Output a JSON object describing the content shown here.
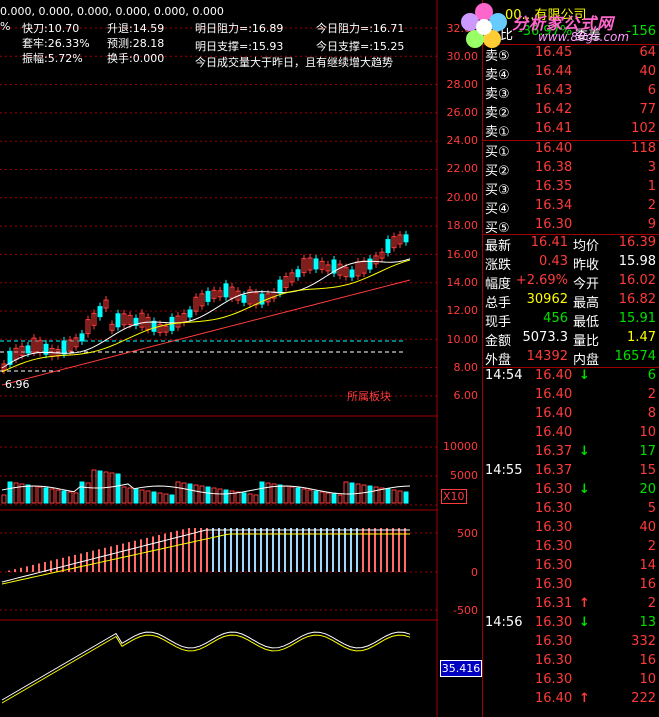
{
  "top_line": "0.000, 0.000, 0.000, 0.000, 0.000, 0.000",
  "info": {
    "kuaidao": "快刀:10.70",
    "shengtui": "升退:14.59",
    "ming_zuli": "明日阻力=:16.89",
    "jin_zuli": "今日阻力=:16.71",
    "pct": "%",
    "taolao": "套牢:26.33%",
    "yuce": "预测:28.18",
    "ming_zhicheng": "明日支撑=:15.93",
    "jin_zhicheng": "今日支撑=:15.25",
    "zhenfu": "振幅:5.72%",
    "huanshou": "换手:0.000",
    "note": "今日成交量大于昨日，且有继续增大趋势"
  },
  "price_axis": [
    "32.00",
    "30.00",
    "28.00",
    "26.00",
    "24.00",
    "22.00",
    "20.00",
    "18.00",
    "16.00",
    "14.00",
    "12.00",
    "10.00",
    "8.00",
    "6.00"
  ],
  "low_label": "6.96",
  "sector_label": "所属板块",
  "vol_axis": [
    "10000",
    "5000"
  ],
  "vol_unit": "X10",
  "macd_axis": [
    "500",
    "0",
    "-500"
  ],
  "kdj_value": "35.416",
  "header": {
    "code": "00",
    "title_rest": "…有限公司",
    "weibi_label": "委比",
    "weibi_value": "-36.97%",
    "weicha_label": "委差",
    "weicha_value": "-156"
  },
  "watermark": {
    "site_cn": "分析家公式网",
    "site_url": "www.88gs.com"
  },
  "sell_orders": [
    {
      "label": "卖⑤",
      "price": "16.45",
      "vol": "64"
    },
    {
      "label": "卖④",
      "price": "16.44",
      "vol": "40"
    },
    {
      "label": "卖③",
      "price": "16.43",
      "vol": "6"
    },
    {
      "label": "卖②",
      "price": "16.42",
      "vol": "77"
    },
    {
      "label": "卖①",
      "price": "16.41",
      "vol": "102"
    }
  ],
  "buy_orders": [
    {
      "label": "买①",
      "price": "16.40",
      "vol": "118"
    },
    {
      "label": "买②",
      "price": "16.38",
      "vol": "3"
    },
    {
      "label": "买③",
      "price": "16.35",
      "vol": "1"
    },
    {
      "label": "买④",
      "price": "16.34",
      "vol": "2"
    },
    {
      "label": "买⑤",
      "price": "16.30",
      "vol": "9"
    }
  ],
  "stats": [
    {
      "l1": "最新",
      "v1": "16.41",
      "l2": "均价",
      "v2": "16.39",
      "c1": "red",
      "c2": "red"
    },
    {
      "l1": "涨跌",
      "v1": "0.43",
      "l2": "昨收",
      "v2": "15.98",
      "c1": "red",
      "c2": "white"
    },
    {
      "l1": "幅度",
      "v1": "+2.69%",
      "l2": "今开",
      "v2": "16.02",
      "c1": "red",
      "c2": "red"
    },
    {
      "l1": "总手",
      "v1": "30962",
      "l2": "最高",
      "v2": "16.82",
      "c1": "yellow",
      "c2": "red"
    },
    {
      "l1": "现手",
      "v1": "456",
      "l2": "最低",
      "v2": "15.91",
      "c1": "green",
      "c2": "green"
    },
    {
      "l1": "金额",
      "v1": "5073.3",
      "l2": "量比",
      "v2": "1.47",
      "c1": "white",
      "c2": "yellow"
    },
    {
      "l1": "外盘",
      "v1": "14392",
      "l2": "内盘",
      "v2": "16574",
      "c1": "red",
      "c2": "green"
    }
  ],
  "ticks": [
    {
      "time": "14:54",
      "price": "16.40",
      "dir": "down",
      "vol": "6",
      "pc": "red",
      "vc": "green"
    },
    {
      "time": "",
      "price": "16.40",
      "dir": "",
      "vol": "2",
      "pc": "red",
      "vc": "red"
    },
    {
      "time": "",
      "price": "16.40",
      "dir": "",
      "vol": "8",
      "pc": "red",
      "vc": "red"
    },
    {
      "time": "",
      "price": "16.40",
      "dir": "",
      "vol": "10",
      "pc": "red",
      "vc": "red"
    },
    {
      "time": "",
      "price": "16.37",
      "dir": "down",
      "vol": "17",
      "pc": "red",
      "vc": "green"
    },
    {
      "time": "14:55",
      "price": "16.37",
      "dir": "",
      "vol": "15",
      "pc": "red",
      "vc": "red"
    },
    {
      "time": "",
      "price": "16.30",
      "dir": "down",
      "vol": "20",
      "pc": "red",
      "vc": "green"
    },
    {
      "time": "",
      "price": "16.30",
      "dir": "",
      "vol": "5",
      "pc": "red",
      "vc": "red"
    },
    {
      "time": "",
      "price": "16.30",
      "dir": "",
      "vol": "40",
      "pc": "red",
      "vc": "red"
    },
    {
      "time": "",
      "price": "16.30",
      "dir": "",
      "vol": "2",
      "pc": "red",
      "vc": "red"
    },
    {
      "time": "",
      "price": "16.30",
      "dir": "",
      "vol": "14",
      "pc": "red",
      "vc": "red"
    },
    {
      "time": "",
      "price": "16.30",
      "dir": "",
      "vol": "16",
      "pc": "red",
      "vc": "red"
    },
    {
      "time": "",
      "price": "16.31",
      "dir": "up",
      "vol": "2",
      "pc": "red",
      "vc": "red"
    },
    {
      "time": "14:56",
      "price": "16.30",
      "dir": "down",
      "vol": "13",
      "pc": "red",
      "vc": "green"
    },
    {
      "time": "",
      "price": "16.30",
      "dir": "",
      "vol": "332",
      "pc": "red",
      "vc": "red"
    },
    {
      "time": "",
      "price": "16.30",
      "dir": "",
      "vol": "16",
      "pc": "red",
      "vc": "red"
    },
    {
      "time": "",
      "price": "16.30",
      "dir": "",
      "vol": "10",
      "pc": "red",
      "vc": "red"
    },
    {
      "time": "",
      "price": "16.40",
      "dir": "up",
      "vol": "222",
      "pc": "red",
      "vc": "red"
    }
  ],
  "colors": {
    "up": "#ff3b3b",
    "down": "#00e000",
    "grid": "#a00000",
    "ma1": "#ffffff",
    "ma2": "#ffff00",
    "ma3": "#ff3b3b",
    "cyan": "#00ffff"
  }
}
